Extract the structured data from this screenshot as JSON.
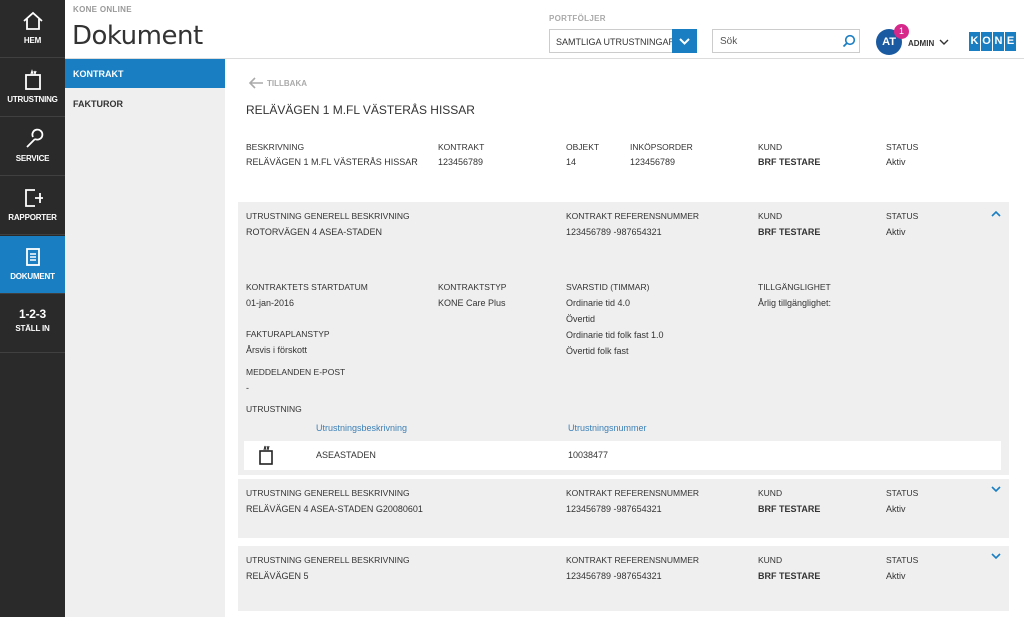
{
  "nav": {
    "items": [
      {
        "label": "HEM"
      },
      {
        "label": "UTRUSTNING"
      },
      {
        "label": "SERVICE"
      },
      {
        "label": "RAPPORTER"
      },
      {
        "label": "DOKUMENT"
      },
      {
        "label": "STÄLL IN",
        "glyph": "1-2-3"
      }
    ],
    "active_color": "#1a7ec3"
  },
  "header": {
    "app_label": "KONE ONLINE",
    "title": "Dokument",
    "portfolio_label": "PORTFÖLJER",
    "portfolio_value": "SAMTLIGA UTRUSTNINGAR",
    "search_placeholder": "Sök",
    "avatar_initials": "AT",
    "notification_count": "1",
    "user_label": "ADMIN",
    "logo_letters": [
      "K",
      "O",
      "N",
      "E"
    ]
  },
  "subnav": {
    "items": [
      {
        "label": "KONTRAKT"
      },
      {
        "label": "FAKTUROR"
      }
    ]
  },
  "main": {
    "back_label": "TILLBAKA",
    "contract_title": "RELÄVÄGEN 1 M.FL VÄSTERÅS HISSAR",
    "summary": {
      "beskrivning_label": "BESKRIVNING",
      "beskrivning_value": "RELÄVÄGEN 1 M.FL VÄSTERÅS HISSAR",
      "kontrakt_label": "KONTRAKT",
      "kontrakt_value": "123456789",
      "objekt_label": "OBJEKT",
      "objekt_value": "14",
      "inkopsorder_label": "INKÖPSORDER",
      "inkopsorder_value": "123456789",
      "kund_label": "KUND",
      "kund_value": "BRF TESTARE",
      "status_label": "STATUS",
      "status_value": "Aktiv"
    },
    "panels": [
      {
        "desc_label": "UTRUSTNING GENERELL BESKRIVNING",
        "desc_value": "ROTORVÄGEN 4 ASEA-STADEN",
        "ref_label": "KONTRAKT REFERENSNUMMER",
        "ref_value": "123456789 -987654321",
        "kund_label": "KUND",
        "kund_value": "BRF TESTARE",
        "status_label": "STATUS",
        "status_value": "Aktiv",
        "expanded": true,
        "details": {
          "startdatum_label": "KONTRAKTETS STARTDATUM",
          "startdatum_value": "01-jan-2016",
          "typ_label": "KONTRAKTSTYP",
          "typ_value": "KONE Care Plus",
          "svarstid_label": "SVARSTID (TIMMAR)",
          "svarstid_lines": [
            "Ordinarie tid 4.0",
            "Övertid",
            "Ordinarie tid folk fast 1.0",
            "Övertid folk fast"
          ],
          "tillganglighet_label": "TILLGÄNGLIGHET",
          "tillganglighet_value": "Årlig tillgänglighet:",
          "fakturaplan_label": "FAKTURAPLANSTYP",
          "fakturaplan_value": "Årsvis i förskott",
          "epost_label": "MEDDELANDEN E-POST",
          "epost_value": "-",
          "utrustning_label": "UTRUSTNING",
          "eq_col_desc": "Utrustningsbeskrivning",
          "eq_col_num": "Utrustningsnummer",
          "eq_rows": [
            {
              "desc": "ASEASTADEN",
              "num": "10038477",
              "icon": "elevator-icon"
            }
          ]
        }
      },
      {
        "desc_label": "UTRUSTNING GENERELL BESKRIVNING",
        "desc_value": "RELÄVÄGEN 4 ASEA-STADEN G20080601",
        "ref_label": "KONTRAKT REFERENSNUMMER",
        "ref_value": "123456789 -987654321",
        "kund_label": "KUND",
        "kund_value": "BRF TESTARE",
        "status_label": "STATUS",
        "status_value": "Aktiv",
        "expanded": false
      },
      {
        "desc_label": "UTRUSTNING GENERELL BESKRIVNING",
        "desc_value": "RELÄVÄGEN 5",
        "ref_label": "KONTRAKT REFERENSNUMMER",
        "ref_value": "123456789 -987654321",
        "kund_label": "KUND",
        "kund_value": "BRF TESTARE",
        "status_label": "STATUS",
        "status_value": "Aktiv",
        "expanded": false
      }
    ]
  }
}
